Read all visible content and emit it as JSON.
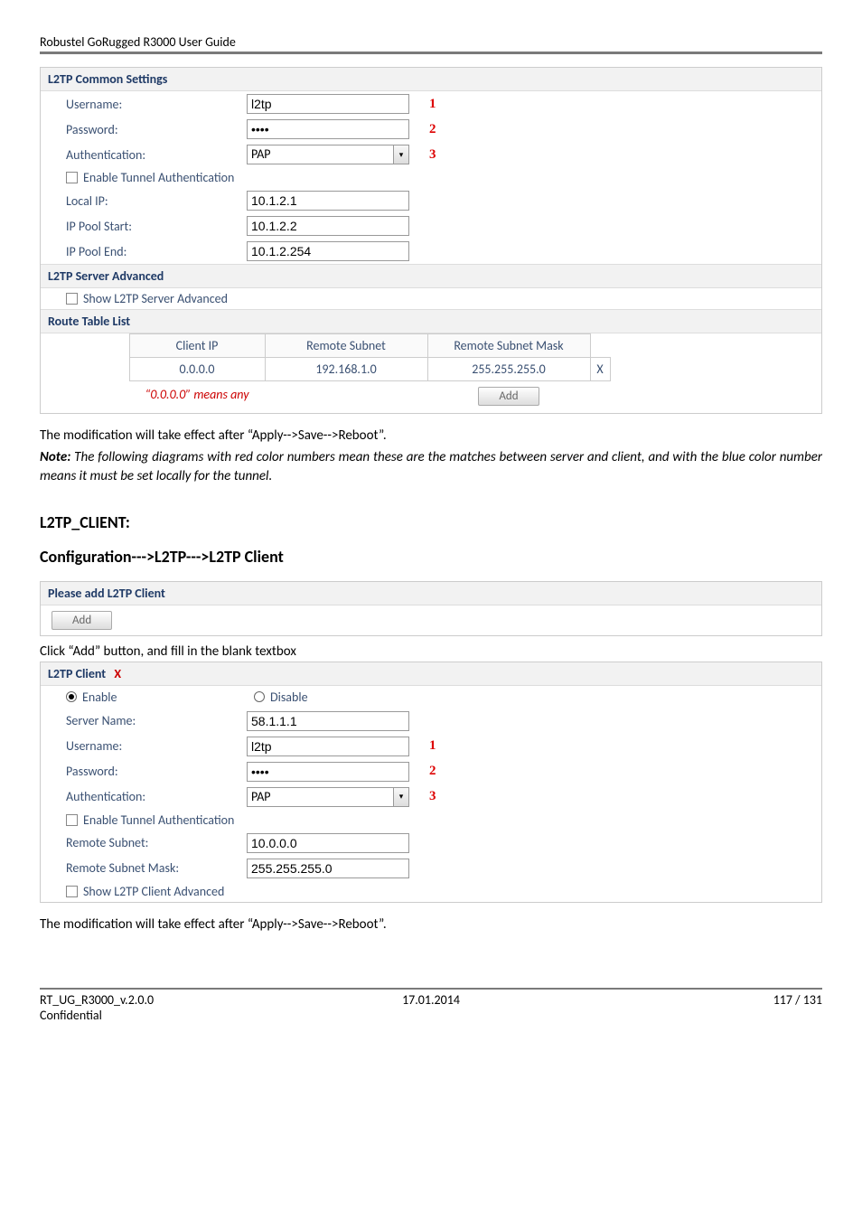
{
  "docHeader": "Robustel GoRugged R3000 User Guide",
  "common": {
    "title": "L2TP Common Settings",
    "usernameLabel": "Username:",
    "usernameValue": "l2tp",
    "passwordLabel": "Password:",
    "passwordValue": "••••",
    "authLabel": "Authentication:",
    "authValue": "PAP",
    "enableTunnelAuth": "Enable Tunnel Authentication",
    "localIpLabel": "Local IP:",
    "localIpValue": "10.1.2.1",
    "ipPoolStartLabel": "IP Pool Start:",
    "ipPoolStartValue": "10.1.2.2",
    "ipPoolEndLabel": "IP Pool End:",
    "ipPoolEndValue": "10.1.2.254",
    "annot1": "1",
    "annot2": "2",
    "annot3": "3"
  },
  "serverAdvanced": {
    "title": "L2TP Server Advanced",
    "showLabel": "Show L2TP Server Advanced"
  },
  "routeTable": {
    "title": "Route Table List",
    "cols": {
      "clientIp": "Client IP",
      "remoteSubnet": "Remote Subnet",
      "remoteSubnetMask": "Remote Subnet Mask"
    },
    "row": {
      "clientIp": "0.0.0.0",
      "remoteSubnet": "192.168.1.0",
      "remoteSubnetMask": "255.255.255.0"
    },
    "delIcon": "X",
    "note": "“0.0.0.0” means any",
    "addLabel": "Add"
  },
  "text1": "The modification will take effect after “Apply-->Save-->Reboot”.",
  "noteLabel": "Note:",
  "noteText": " The following diagrams with red color numbers mean these are the matches between server and client, and with the blue color number means it must be set locally for the tunnel.",
  "h1": "L2TP_CLIENT:",
  "h2": "Configuration--->L2TP--->L2TP Client",
  "pleaseAdd": {
    "title": "Please add L2TP Client",
    "addLabel": "Add"
  },
  "text2": "Click “Add” button, and fill in the blank textbox",
  "client": {
    "title": "L2TP Client",
    "closeIcon": "X",
    "enable": "Enable",
    "disable": "Disable",
    "serverNameLabel": "Server Name:",
    "serverNameValue": "58.1.1.1",
    "usernameLabel": "Username:",
    "usernameValue": "l2tp",
    "passwordLabel": "Password:",
    "passwordValue": "••••",
    "authLabel": "Authentication:",
    "authValue": "PAP",
    "enableTunnelAuth": "Enable Tunnel Authentication",
    "remoteSubnetLabel": "Remote Subnet:",
    "remoteSubnetValue": "10.0.0.0",
    "remoteSubnetMaskLabel": "Remote Subnet Mask:",
    "remoteSubnetMaskValue": "255.255.255.0",
    "showAdvanced": "Show L2TP Client Advanced",
    "annot1": "1",
    "annot2": "2",
    "annot3": "3"
  },
  "text3": "The modification will take effect after “Apply-->Save-->Reboot”.",
  "footer": {
    "left1": "RT_UG_R3000_v.2.0.0",
    "left2": "Confidential",
    "center": "17.01.2014",
    "right": "117 / 131"
  }
}
